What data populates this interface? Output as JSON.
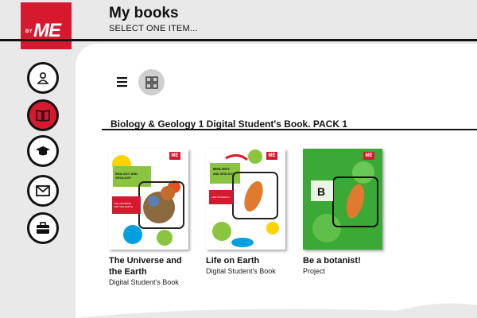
{
  "header": {
    "title": "My books",
    "subtitle": "SELECT ONE ITEM...",
    "logo_by": "BY",
    "logo_me": "ME"
  },
  "sidebar": {
    "items": [
      {
        "name": "profile",
        "icon": "user-icon"
      },
      {
        "name": "books",
        "icon": "book-icon",
        "active": true
      },
      {
        "name": "courses",
        "icon": "graduation-cap-icon"
      },
      {
        "name": "messages",
        "icon": "envelope-icon"
      },
      {
        "name": "resources",
        "icon": "briefcase-icon"
      }
    ]
  },
  "toolbar": {
    "list_icon": "list-icon",
    "grid_icon": "grid-icon",
    "selected_view": "grid"
  },
  "pack": {
    "title": "Biology & Geology 1 Digital Student's Book. PACK 1"
  },
  "books": [
    {
      "title": "The Universe and the Earth",
      "type": "Digital Student's Book",
      "cover_text": "BIOLOGY AND GEOLOGY",
      "cover_sub": "THE UNIVERSE AND THE EARTH",
      "badge": "ME"
    },
    {
      "title": "Life on Earth",
      "type": "Digital Student's Book",
      "cover_text": "BIOLOGY AND GEOLOGY",
      "cover_sub": "LIFE ON EARTH",
      "badge": "ME"
    },
    {
      "title": "Be a botanist!",
      "type": "Project",
      "cover_letter": "B",
      "badge": "ME"
    }
  ],
  "colors": {
    "brand_red": "#d7192f",
    "cover_green": "#3aa935",
    "background": "#e9e9e9"
  }
}
